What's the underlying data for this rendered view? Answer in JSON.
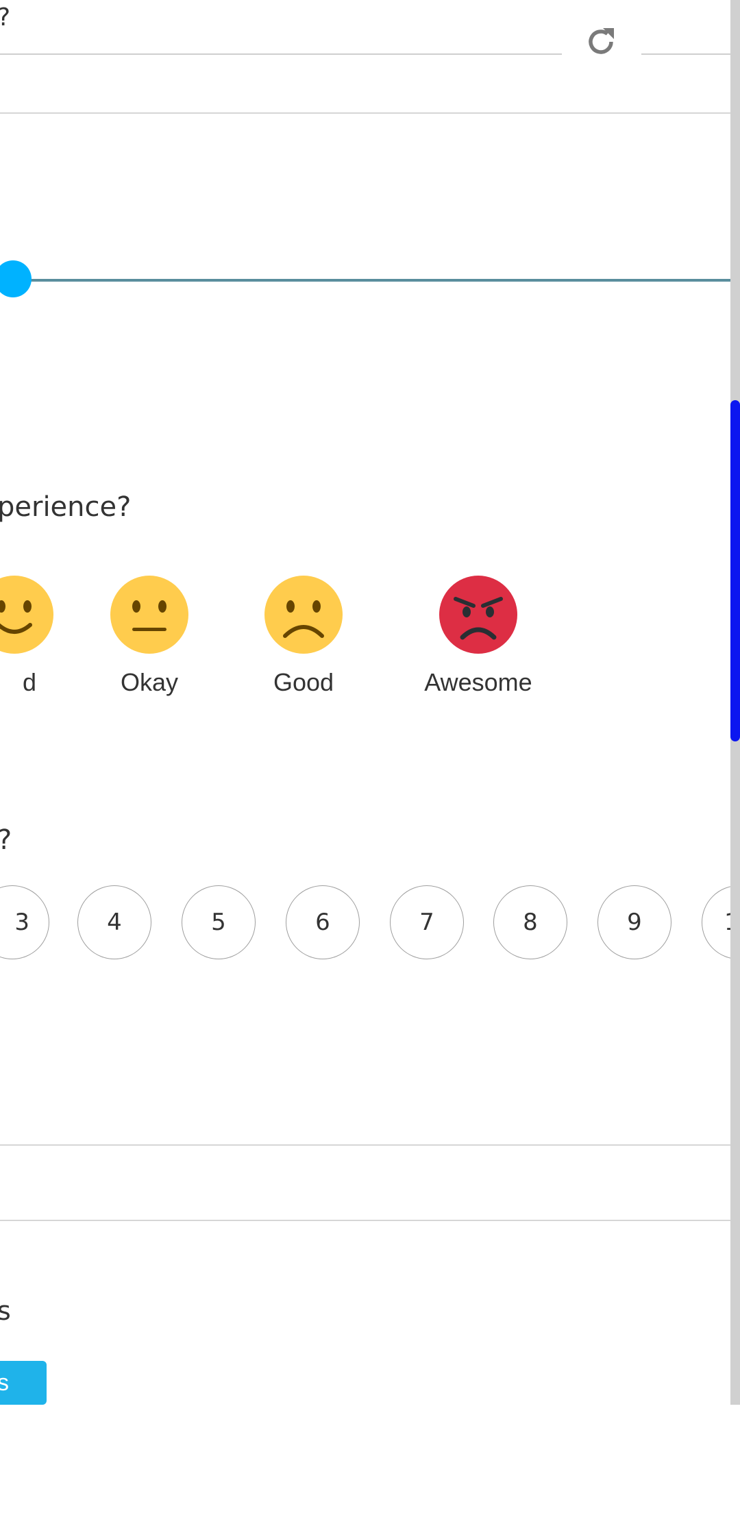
{
  "question1": {
    "fragment": "?"
  },
  "refresh": {
    "icon": "refresh-icon",
    "color": "#7a7a7a"
  },
  "slider": {
    "value_fraction": 0.0,
    "track_color": "#5a8e9d",
    "thumb_color": "#00b2ff"
  },
  "question2": {
    "fragment": "perience?",
    "options": [
      {
        "label": "d",
        "icon": "slightly-smiling-face-icon",
        "color": "#ffcc4d"
      },
      {
        "label": "Okay",
        "icon": "neutral-face-icon",
        "color": "#ffcc4d"
      },
      {
        "label": "Good",
        "icon": "frowning-face-icon",
        "color": "#ffcc4d"
      },
      {
        "label": "Awesome",
        "icon": "angry-face-icon",
        "color": "#dd2e44"
      }
    ]
  },
  "question3": {
    "fragment": "?",
    "scale": [
      "3",
      "4",
      "5",
      "6",
      "7",
      "8",
      "9",
      "1"
    ]
  },
  "question4": {
    "fragment": "s"
  },
  "submit": {
    "label": "s",
    "color": "#1fb3ea"
  },
  "scrollbar": {
    "thumb_color": "#0c16f0"
  }
}
